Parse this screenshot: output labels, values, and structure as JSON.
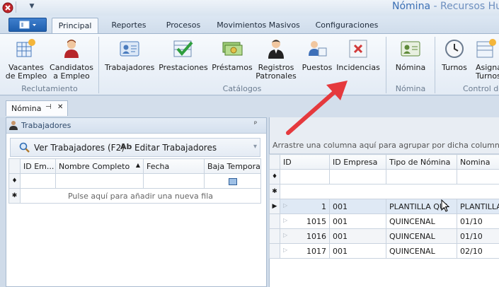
{
  "window": {
    "title_app": "Nómina",
    "title_sep": " - ",
    "title_rest": "Recursos Huma"
  },
  "ribbon_tabs": [
    {
      "label": "Principal",
      "active": true
    },
    {
      "label": "Reportes"
    },
    {
      "label": "Procesos"
    },
    {
      "label": "Movimientos Masivos"
    },
    {
      "label": "Configuraciones"
    }
  ],
  "ribbon": {
    "vacantes": "Vacantes\nde Empleo",
    "candidatos": "Candidatos\na Empleo",
    "reclutamiento_group": "Reclutamiento",
    "trabajadores": "Trabajadores",
    "prestaciones": "Prestaciones",
    "prestamos": "Préstamos",
    "registros": "Registros\nPatronales",
    "puestos": "Puestos",
    "incidencias": "Incidencias",
    "catalogos_group": "Catálogos",
    "nomina": "Nómina",
    "nomina_group": "Nómina",
    "turnos": "Turnos",
    "asignar": "Asignar\nTurnos",
    "control_group": "Control de"
  },
  "doc_tab": {
    "label": "Nómina",
    "pin": "⊣",
    "close": "✕"
  },
  "left_panel": {
    "title": "Trabajadores",
    "pin": "ᵖ",
    "toolbar": {
      "ver_label": "Ver Trabajadores (F2)",
      "editar_label": "Editar Trabajadores",
      "dropdown": "▾"
    },
    "columns": [
      "ID Em...",
      "Nombre Completo",
      "Fecha",
      "Baja Temporal"
    ],
    "sort_glyph": "▲",
    "new_row_text": "Pulse aquí para añadir una nueva fila"
  },
  "right_panel": {
    "group_hint": "Arrastre una columna aquí para agrupar por dicha columna",
    "columns": [
      "ID",
      "ID Empresa",
      "Tipo de Nómina",
      "Nomina"
    ],
    "rows": [
      {
        "id": "1",
        "empresa": "001",
        "tipo": "PLANTILLA QUI",
        "nomina": "PLANTILLA"
      },
      {
        "id": "1015",
        "empresa": "001",
        "tipo": "QUINCENAL",
        "nomina": "01/10"
      },
      {
        "id": "1016",
        "empresa": "001",
        "tipo": "QUINCENAL",
        "nomina": "01/10"
      },
      {
        "id": "1017",
        "empresa": "001",
        "tipo": "QUINCENAL",
        "nomina": "02/10"
      }
    ]
  },
  "glyphs": {
    "filter": "♦",
    "newrow": "✱",
    "current": "▶",
    "expand": "▷"
  },
  "colors": {
    "accent": "#3b6fb4",
    "annotation_arrow": "#e5393d"
  }
}
